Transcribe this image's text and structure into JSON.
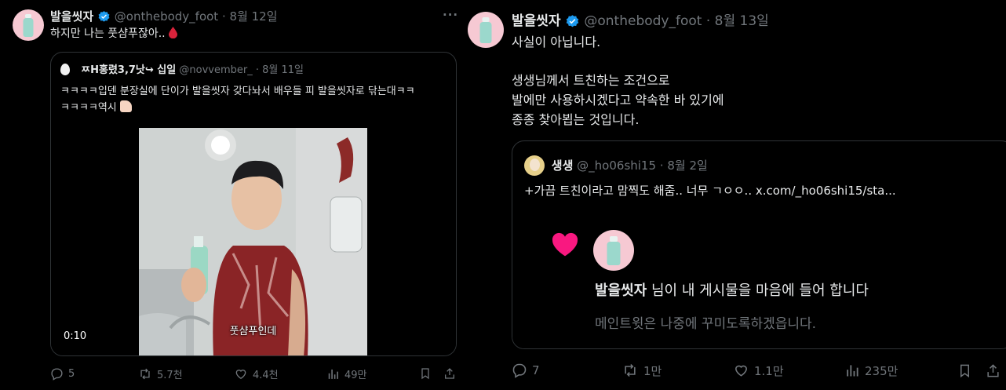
{
  "left_post": {
    "author_name": "발을씻자",
    "handle": "@onthebody_foot",
    "date": "8월 12일",
    "text": "하지만 나는 풋샴푸잖아..",
    "quote": {
      "author_name": "ㅉH홍렸3,7낫↪ 십일",
      "handle": "@novvember_",
      "date": "8월 11일",
      "text_line1": "ㅋㅋㅋㅋ입덴 분장실에 단이가 발을씻자 갖다놔서 배우들 피 발을씻자로 닦는대ㅋㅋ",
      "text_line2": "ㅋㅋㅋㅋ역시",
      "video_time": "0:10",
      "video_caption": "풋샴푸인데"
    },
    "stats": {
      "replies": "5",
      "reposts": "5.7천",
      "likes": "4.4천",
      "views": "49만"
    }
  },
  "right_post": {
    "author_name": "발을씻자",
    "handle": "@onthebody_foot",
    "date": "8월 13일",
    "lines": [
      "사실이 아닙니다.",
      "생생님께서 트친하는 조건으로",
      "발에만 사용하시겠다고 약속한 바 있기에",
      "종종 찾아뵙는 것입니다."
    ],
    "quote": {
      "author_name": "생생",
      "handle": "@_ho06shi15",
      "date": "8월 2일",
      "text": "+가끔 트친이라고 맘찍도 해줌.. 너무 ㄱㅇㅇ..  x.com/_ho06shi15/sta...",
      "notif_name": "발을씻자",
      "notif_text": " 님이 내 게시물을 마음에 들어 합니다",
      "notif_sub": "메인트윗은 나중에 꾸미도록하겠읍니다."
    },
    "stats": {
      "replies": "7",
      "reposts": "1만",
      "likes": "1.1만",
      "views": "235만"
    }
  },
  "colors": {
    "accent_blue": "#1d9bf0",
    "muted": "#71767b",
    "border": "#2f3336",
    "heart_pink": "#f91880"
  }
}
